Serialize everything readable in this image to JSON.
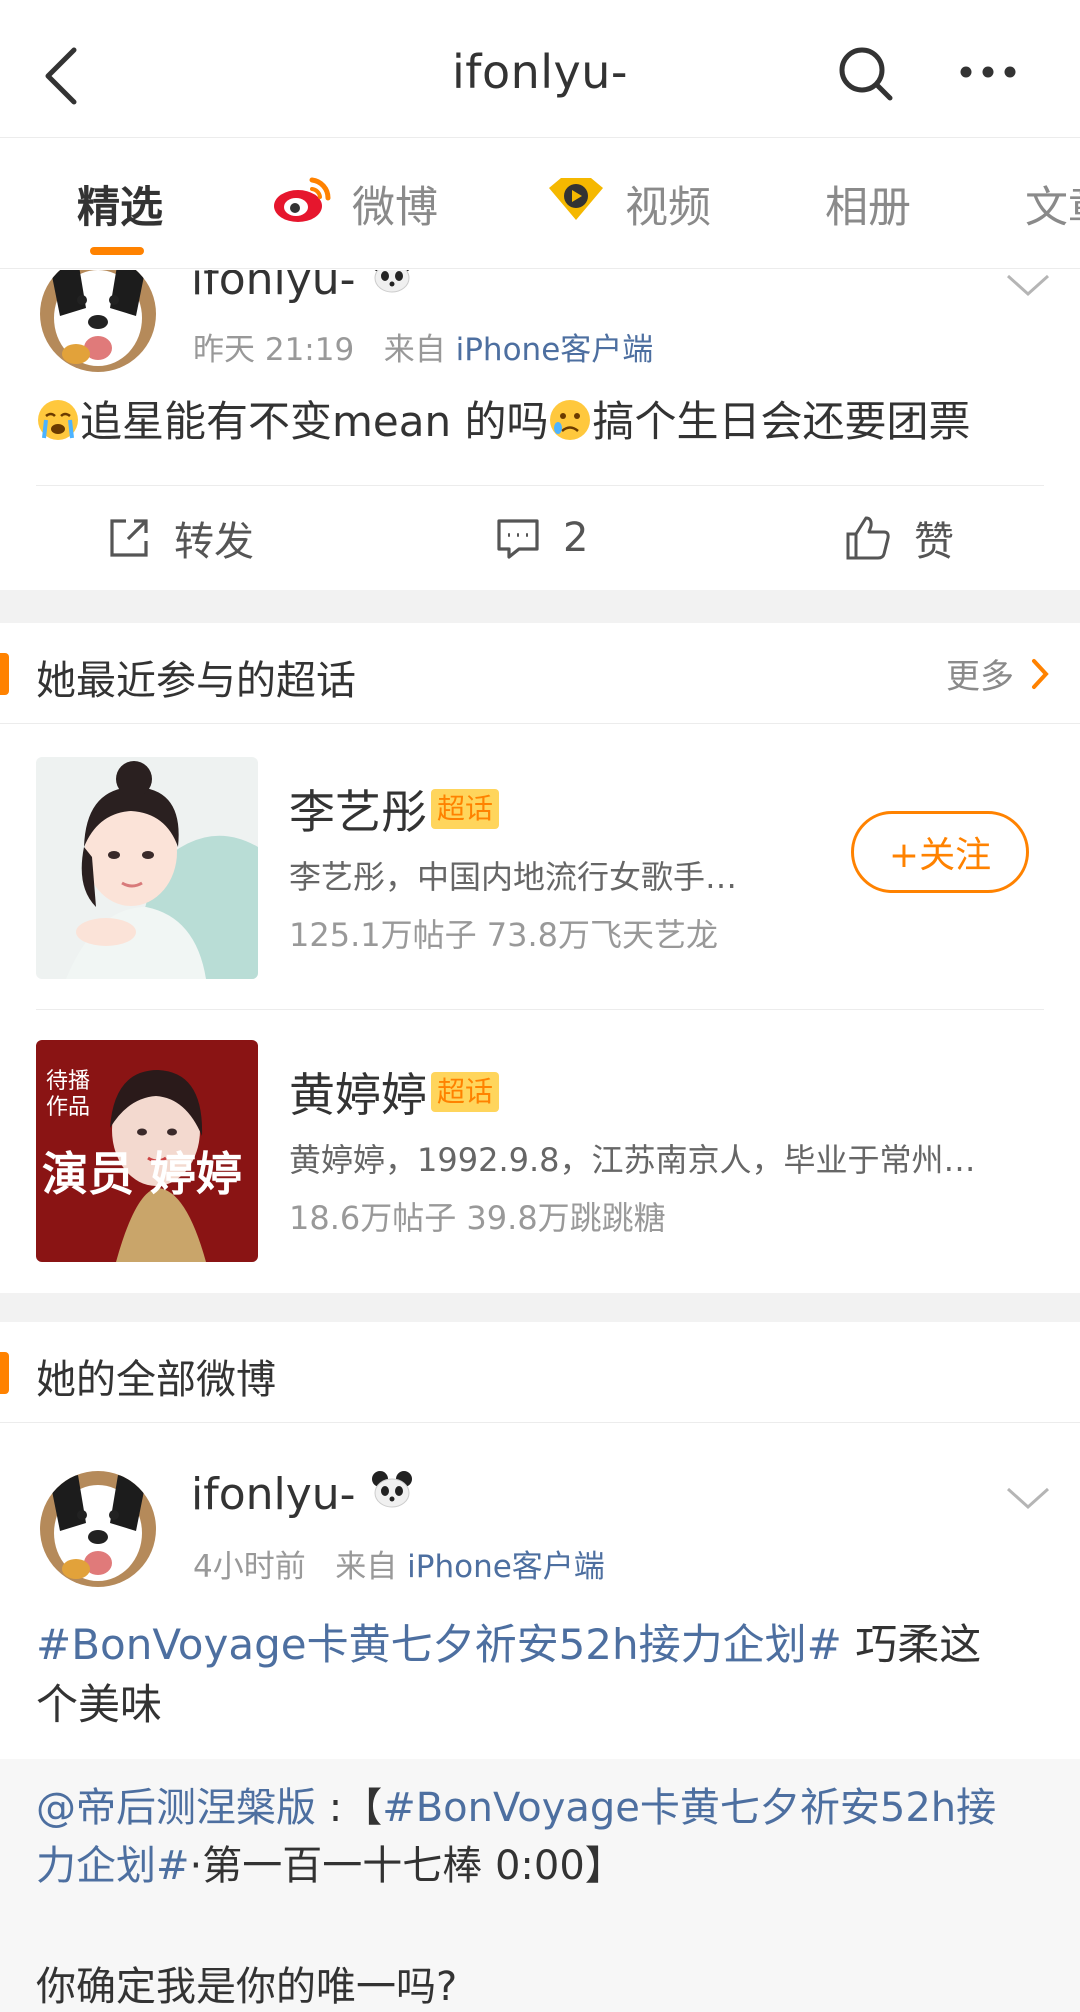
{
  "header": {
    "title": "ifonlyu-"
  },
  "tabs": [
    {
      "label": "精选",
      "active": true
    },
    {
      "label": "微博",
      "icon": "weibo-logo-icon"
    },
    {
      "label": "视频",
      "icon": "video-icon"
    },
    {
      "label": "相册"
    },
    {
      "label": "文章"
    }
  ],
  "post1": {
    "username": "ifonlyu-",
    "badge_icon": "panda-icon",
    "time": "昨天 21:19",
    "source_prefix": "来自",
    "source": "iPhone客户端",
    "text": "追星能有不变mean 的吗",
    "text2": "搞个生日会还要团票",
    "actions": {
      "repost": "转发",
      "comment_count": "2",
      "like": "赞"
    }
  },
  "super_topics": {
    "title": "她最近参与的超话",
    "more": "更多",
    "items": [
      {
        "name": "李艺彤",
        "badge": "超话",
        "desc": "李艺彤，中国内地流行女歌手…",
        "stats": "125.1万帖子 73.8万飞天艺龙",
        "follow": "+关注"
      },
      {
        "name": "黄婷婷",
        "badge": "超话",
        "desc": "黄婷婷，1992.9.8，江苏南京人，毕业于常州…",
        "stats": "18.6万帖子 39.8万跳跳糖",
        "poster_text_1": "待播",
        "poster_text_2": "作品",
        "poster_text_3": "演员",
        "poster_text_4": "婷婷"
      }
    ]
  },
  "all_posts": {
    "title": "她的全部微博"
  },
  "post2": {
    "username": "ifonlyu-",
    "badge_icon": "panda-icon",
    "time": "4小时前",
    "source_prefix": "来自",
    "source": "iPhone客户端",
    "hashtag": "#BonVoyage卡黄七夕祈安52h接力企划#",
    "text_line1_rest": " 巧柔这",
    "text_line2": "个美味",
    "quote_mention": "@帝后测涅槃版",
    "quote_colon": " :【",
    "quote_hashtag_a": "#BonVoyage卡黄七夕祈安52h接",
    "quote_hashtag_b": "力企划#",
    "quote_rest": "·第一百一十七棒 0:00】",
    "quote_line3": "你确定我是你的唯一吗?"
  },
  "colors": {
    "accent": "#ff8200",
    "link": "#4d6fa0",
    "muted": "#999999",
    "gap": "#f2f2f2"
  }
}
